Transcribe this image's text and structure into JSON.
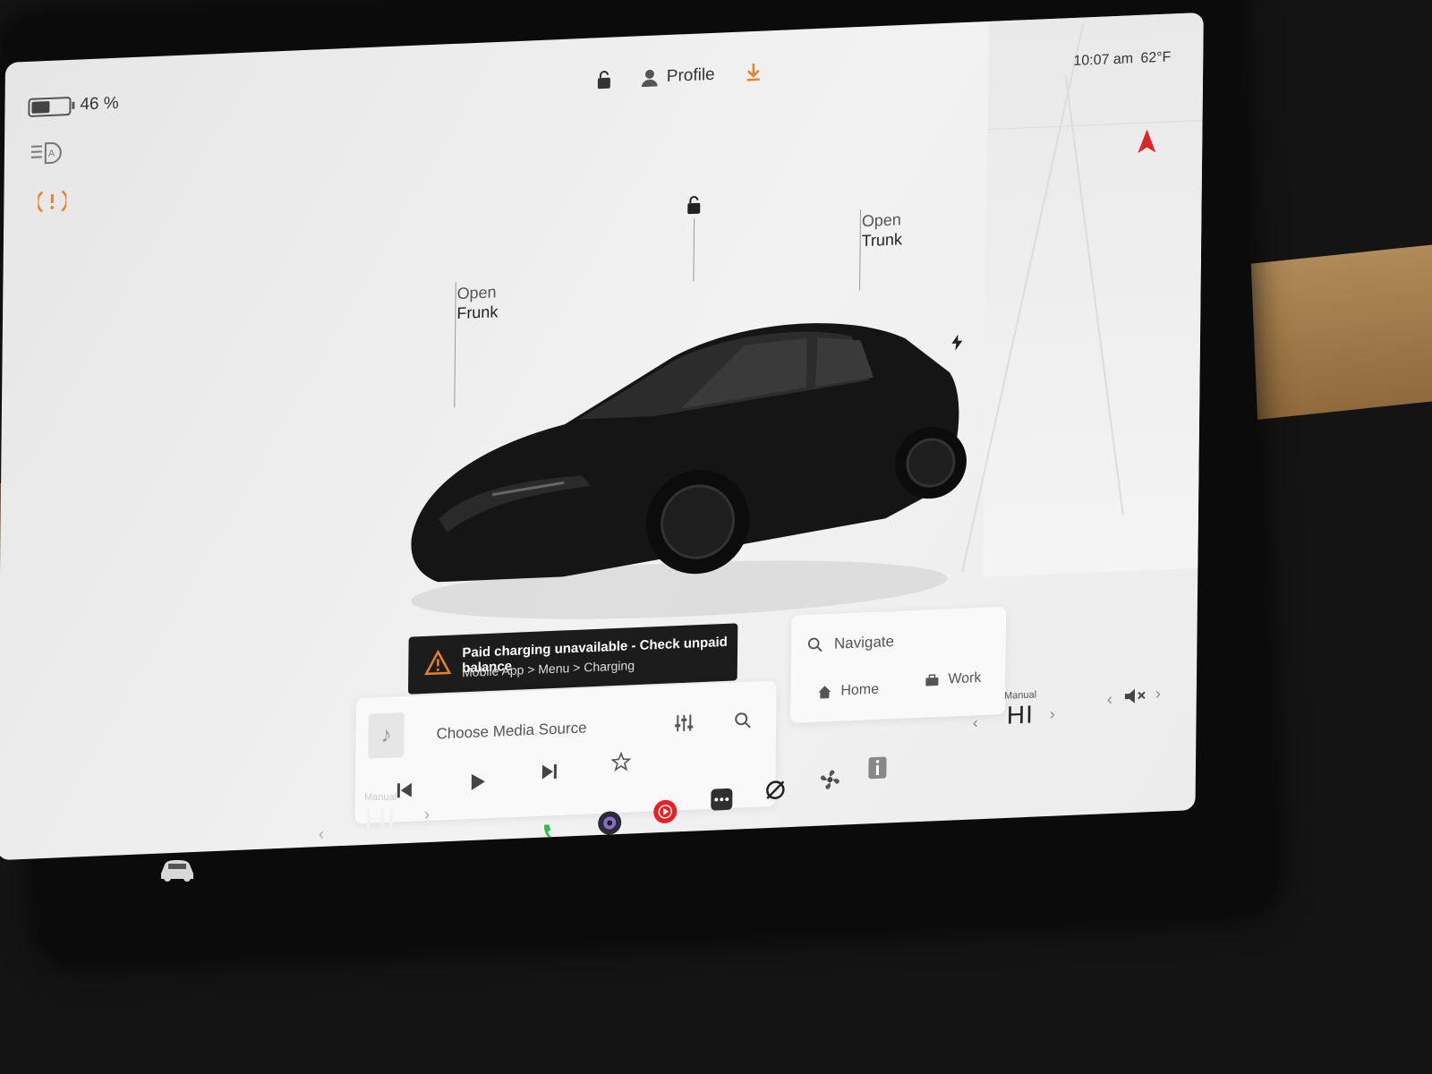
{
  "status": {
    "battery_percent": 46,
    "battery_label": "46 %",
    "profile_label": "Profile",
    "time": "10:07 am",
    "temperature": "62°F"
  },
  "car_controls": {
    "frunk": {
      "line1": "Open",
      "line2": "Frunk"
    },
    "trunk": {
      "line1": "Open",
      "line2": "Trunk"
    }
  },
  "alert": {
    "title": "Paid charging unavailable - Check unpaid balance",
    "subtitle": "Mobile App > Menu > Charging"
  },
  "media": {
    "placeholder": "Choose Media Source"
  },
  "navigation": {
    "search_label": "Navigate",
    "home_label": "Home",
    "work_label": "Work"
  },
  "climate": {
    "left": {
      "mode": "Manual",
      "value": "HI"
    },
    "right": {
      "mode": "Manual",
      "value": "HI"
    }
  },
  "colors": {
    "accent_orange": "#e8822a",
    "nav_red": "#e0242b",
    "phone_green": "#2dbf4e",
    "youtube_red": "#ee1c24"
  },
  "icons": [
    "battery-icon",
    "lock-icon",
    "profile-icon",
    "download-icon",
    "headlight-auto-icon",
    "tire-pressure-warning-icon",
    "nav-arrow-icon",
    "charge-port-icon",
    "warning-icon",
    "music-note-icon",
    "equalizer-icon",
    "search-icon",
    "home-icon",
    "briefcase-icon",
    "prev-track-icon",
    "play-icon",
    "next-track-icon",
    "star-icon",
    "car-icon",
    "phone-icon",
    "camera-icon",
    "youtube-music-icon",
    "more-apps-icon",
    "bluetooth-off-icon",
    "fan-icon",
    "info-icon",
    "volume-muted-icon"
  ]
}
